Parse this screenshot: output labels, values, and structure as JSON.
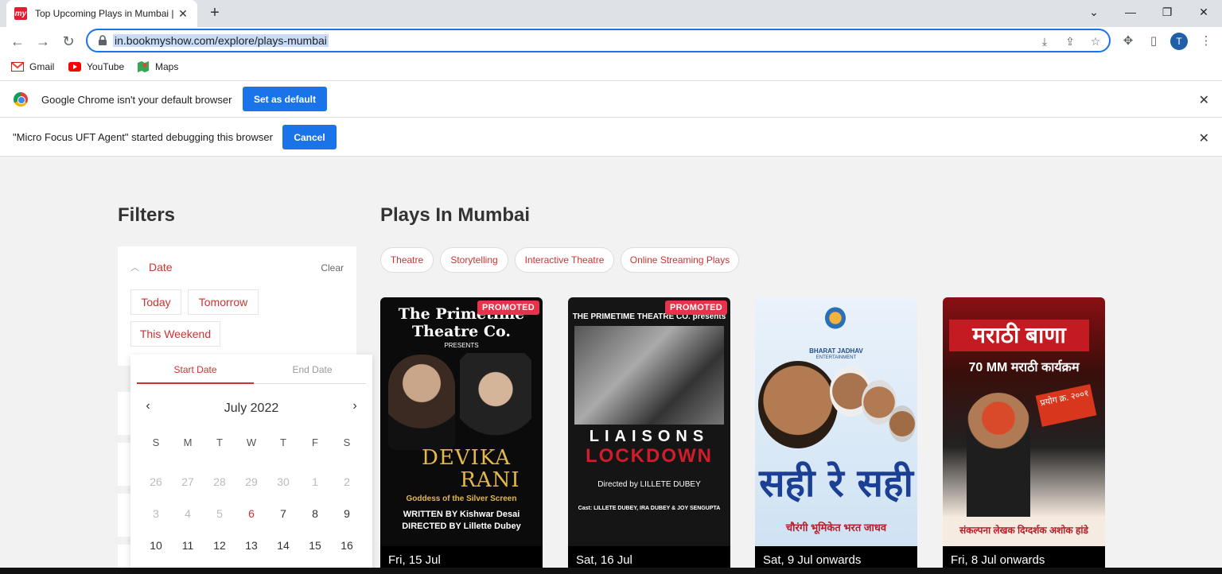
{
  "browser": {
    "tab_title": "Top Upcoming Plays in Mumbai |",
    "url": "in.bookmyshow.com/explore/plays-mumbai",
    "profile_initial": "T",
    "bookmarks": [
      {
        "label": "Gmail",
        "icon": "gmail-icon"
      },
      {
        "label": "YouTube",
        "icon": "youtube-icon"
      },
      {
        "label": "Maps",
        "icon": "maps-icon"
      }
    ]
  },
  "infobars": {
    "default_browser": {
      "message": "Google Chrome isn't your default browser",
      "action": "Set as default"
    },
    "debugging": {
      "message": "\"Micro Focus UFT Agent\" started debugging this browser",
      "action": "Cancel"
    }
  },
  "filters": {
    "title": "Filters",
    "date": {
      "label": "Date",
      "clear": "Clear",
      "options": [
        "Today",
        "Tomorrow",
        "This Weekend"
      ]
    },
    "datepicker": {
      "start_tab": "Start Date",
      "end_tab": "End Date",
      "month": "July 2022",
      "weekdays": [
        "S",
        "M",
        "T",
        "W",
        "T",
        "F",
        "S"
      ],
      "weeks": [
        [
          {
            "d": "26",
            "dim": true
          },
          {
            "d": "27",
            "dim": true
          },
          {
            "d": "28",
            "dim": true
          },
          {
            "d": "29",
            "dim": true
          },
          {
            "d": "30",
            "dim": true
          },
          {
            "d": "1",
            "dim": true
          },
          {
            "d": "2",
            "dim": true
          }
        ],
        [
          {
            "d": "3",
            "dim": true
          },
          {
            "d": "4",
            "dim": true
          },
          {
            "d": "5",
            "dim": true
          },
          {
            "d": "6",
            "today": true
          },
          {
            "d": "7"
          },
          {
            "d": "8"
          },
          {
            "d": "9"
          }
        ],
        [
          {
            "d": "10"
          },
          {
            "d": "11"
          },
          {
            "d": "12"
          },
          {
            "d": "13"
          },
          {
            "d": "14"
          },
          {
            "d": "15"
          },
          {
            "d": "16"
          }
        ]
      ]
    }
  },
  "plays": {
    "title": "Plays In Mumbai",
    "genres": [
      "Theatre",
      "Storytelling",
      "Interactive Theatre",
      "Online Streaming Plays"
    ],
    "cards": [
      {
        "date": "Fri, 15 Jul",
        "promoted": "PROMOTED",
        "poster": {
          "company": "The Primetime",
          "company2": "Theatre Co.",
          "presents": "PRESENTS",
          "title1": "DEVIKA",
          "title2": "RANI",
          "tagline": "Goddess of the Silver Screen",
          "written": "WRITTEN BY Kishwar Desai",
          "directed": "DIRECTED BY Lillette Dubey"
        }
      },
      {
        "date": "Sat, 16 Jul",
        "promoted": "PROMOTED",
        "poster": {
          "company": "THE PRIMETIME THEATRE CO. presents",
          "title1": "LIAISONS",
          "title2": "LOCKDOWN",
          "directed": "Directed by LILLETE DUBEY",
          "cast": "Cast: LILLETE DUBEY, IRA DUBEY & JOY SENGUPTA"
        }
      },
      {
        "date": "Sat, 9 Jul onwards",
        "poster": {
          "producer": "BHARAT JADHAV",
          "producer_sub": "ENTERTAINMENT",
          "title": "सही रे सही",
          "subtitle": "चौरंगी भूमिकेत भरत जाधव"
        }
      },
      {
        "date": "Fri, 8 Jul onwards",
        "poster": {
          "title": "मराठी बाणा",
          "subtitle": "70 MM मराठी कार्यक्रम",
          "flag": "प्रयोग क्र. २००१",
          "footer": "संकल्पना लेखक दिग्दर्शक अशोक हांडे"
        }
      }
    ]
  },
  "colors": {
    "accent": "#cc3333",
    "promoted": "#e6334b",
    "chrome_blue": "#1a73e8"
  }
}
